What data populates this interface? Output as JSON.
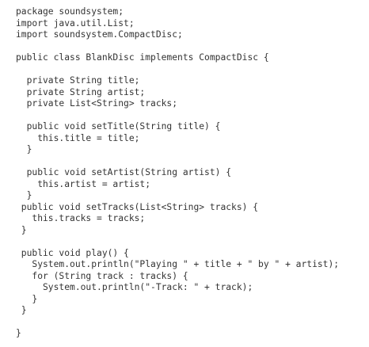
{
  "code_lines": [
    "package soundsystem;",
    "import java.util.List;",
    "import soundsystem.CompactDisc;",
    "",
    "public class BlankDisc implements CompactDisc {",
    "",
    "  private String title;",
    "  private String artist;",
    "  private List<String> tracks;",
    "",
    "  public void setTitle(String title) {",
    "    this.title = title;",
    "  }",
    "",
    "  public void setArtist(String artist) {",
    "    this.artist = artist;",
    "  }",
    " public void setTracks(List<String> tracks) {",
    "   this.tracks = tracks;",
    " }",
    "",
    " public void play() {",
    "   System.out.println(\"Playing \" + title + \" by \" + artist);",
    "   for (String track : tracks) {",
    "     System.out.println(\"-Track: \" + track);",
    "   }",
    " }",
    "",
    "}"
  ]
}
